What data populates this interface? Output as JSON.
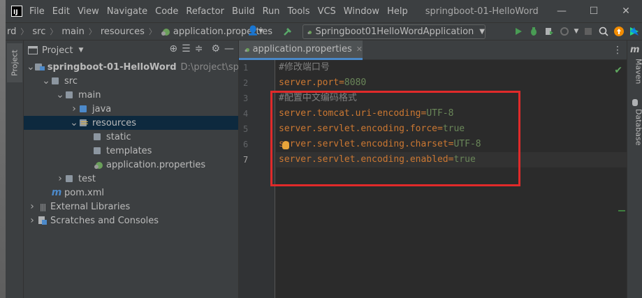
{
  "app": {
    "window_title": "springboot-01-HelloWord",
    "logo_text": "IJ"
  },
  "menu": [
    {
      "label": "File"
    },
    {
      "label": "Edit"
    },
    {
      "label": "View"
    },
    {
      "label": "Navigate"
    },
    {
      "label": "Code"
    },
    {
      "label": "Refactor"
    },
    {
      "label": "Build"
    },
    {
      "label": "Run"
    },
    {
      "label": "Tools"
    },
    {
      "label": "VCS"
    },
    {
      "label": "Window"
    },
    {
      "label": "Help"
    }
  ],
  "window_controls": {
    "minimize": "—",
    "maximize": "☐",
    "close": "✕"
  },
  "breadcrumb": {
    "root_partial": "rd",
    "items": [
      "src",
      "main",
      "resources",
      "application.properties"
    ]
  },
  "run_config": {
    "label": "Springboot01HelloWordApplication"
  },
  "left_strip": {
    "project_tab": "Project"
  },
  "project_panel": {
    "title": "Project",
    "tree": [
      {
        "label": "springboot-01-HelloWord",
        "path": "D:\\project\\springl",
        "depth": 0,
        "arrow": "v",
        "icon": "module-folder-icon",
        "bold": true
      },
      {
        "label": "src",
        "depth": 1,
        "arrow": "v",
        "icon": "folder-icon"
      },
      {
        "label": "main",
        "depth": 2,
        "arrow": "v",
        "icon": "folder-icon"
      },
      {
        "label": "java",
        "depth": 3,
        "arrow": ">",
        "icon": "source-folder-icon"
      },
      {
        "label": "resources",
        "depth": 3,
        "arrow": "v",
        "icon": "resources-folder-icon",
        "selected": true
      },
      {
        "label": "static",
        "depth": 4,
        "arrow": "",
        "icon": "folder-icon"
      },
      {
        "label": "templates",
        "depth": 4,
        "arrow": "",
        "icon": "folder-icon"
      },
      {
        "label": "application.properties",
        "depth": 4,
        "arrow": "",
        "icon": "spring-properties-icon"
      },
      {
        "label": "test",
        "depth": 2,
        "arrow": ">",
        "icon": "folder-icon"
      },
      {
        "label": "pom.xml",
        "depth": 1,
        "arrow": "",
        "icon": "maven-icon"
      },
      {
        "label": "External Libraries",
        "depth": 0,
        "arrow": ">",
        "icon": "libraries-icon"
      },
      {
        "label": "Scratches and Consoles",
        "depth": 0,
        "arrow": ">",
        "icon": "scratches-icon"
      }
    ]
  },
  "editor": {
    "tab_label": "application.properties",
    "lines": [
      {
        "num": "1",
        "comment": "#修改端口号"
      },
      {
        "num": "2",
        "key": "server.port",
        "value": "8080"
      },
      {
        "num": "3",
        "comment": "#配置中文编码格式"
      },
      {
        "num": "4",
        "key": "server.tomcat.uri-encoding",
        "value": "UTF-8"
      },
      {
        "num": "5",
        "key": "server.servlet.encoding.force",
        "value": "true"
      },
      {
        "num": "6",
        "key": "server.servlet.encoding.charset",
        "value": "UTF-8"
      },
      {
        "num": "7",
        "key": "server.servlet.encoding.enabled",
        "value": "true"
      }
    ],
    "current_line": "7"
  },
  "right_strip": {
    "maven": "Maven",
    "database": "Database"
  },
  "colors": {
    "annotation_box": "#e02a2a",
    "keyword": "#cc7832",
    "value": "#6a8759",
    "comment": "#808080",
    "selection": "#0d293e"
  }
}
